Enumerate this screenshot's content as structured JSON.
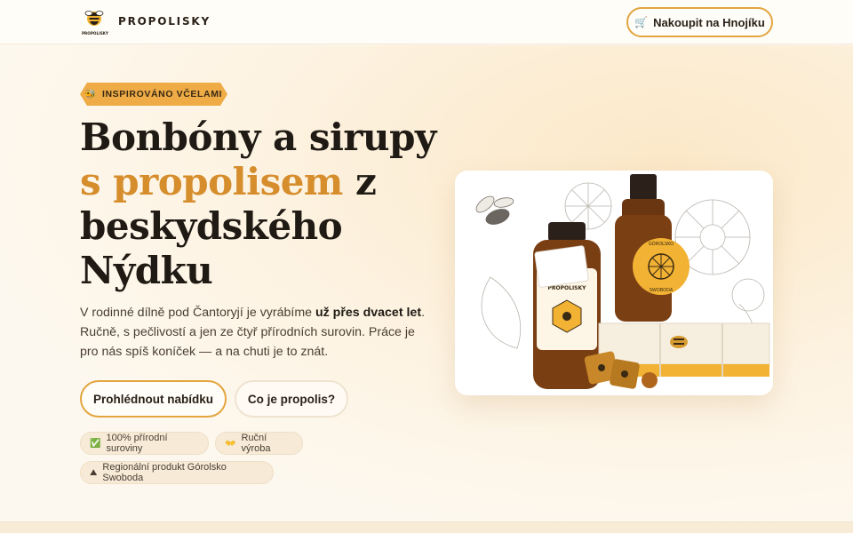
{
  "header": {
    "brand": "PROPOLISKY",
    "logo_text": "PROPOLISKY",
    "logo_icon": "bee-logo-icon",
    "shop_button": {
      "icon": "cart-icon",
      "icon_glyph": "🛒",
      "label": "Nakoupit na Hnojíku"
    }
  },
  "hero": {
    "badge": {
      "icon": "bee-icon",
      "icon_glyph": "🐝",
      "label": "INSPIROVÁNO VČELAMI"
    },
    "headline": {
      "part1": "Bonbóny a sirupy ",
      "accent": "s propolisem",
      "part2": " z beskydského Nýdku"
    },
    "lead": {
      "before": "V rodinné dílně pod Čantoryjí je vyrábíme ",
      "bold": "už přes dvacet let",
      "after": ". Ručně, s pečlivostí a jen ze čtyř přírodních surovin. Práce je pro nás spíš koníček — a na chuti je to znát."
    },
    "buttons": {
      "primary": "Prohlédnout nabídku",
      "secondary": "Co je propolis?"
    },
    "chips": [
      {
        "icon": "check-icon",
        "glyph": "✅",
        "label": "100% přírodní suroviny"
      },
      {
        "icon": "hands-icon",
        "glyph": "👐",
        "label": "Ruční výroba"
      },
      {
        "icon": "mountain-icon",
        "glyph": "⛰",
        "label": "Regionální produkt Górolsko Swoboda"
      }
    ]
  },
  "product_image": {
    "bottle_small_label": "PROPOLISKY",
    "bottle_large_label_top": "GÓROLSKO",
    "bottle_large_label_bottom": "SWOBODA"
  },
  "colors": {
    "accent": "#d68d2c",
    "button_border": "#e2a53f",
    "badge_bg": "#eeab46",
    "text": "#1f1a14"
  }
}
